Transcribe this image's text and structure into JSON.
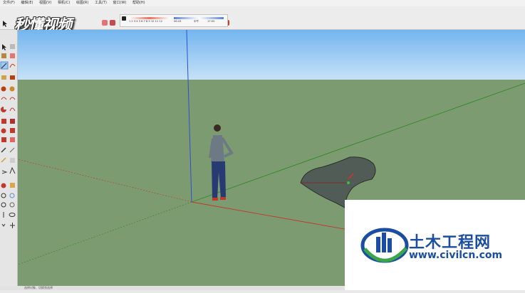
{
  "menu": {
    "items": [
      "文件(F)",
      "编辑(E)",
      "视图(V)",
      "相机(C)",
      "绘图(R)",
      "工具(T)",
      "窗口(W)",
      "帮助(H)"
    ]
  },
  "watermark": {
    "text": "秒懂视频"
  },
  "shadow_panel": {
    "months": "1 2 3 4 5 6 7 8 9 10 11 12",
    "time_start": "06:43",
    "time_mid": "中午",
    "time_end": "17:00"
  },
  "logo": {
    "name_cn": "土木工程网",
    "url": "www.civilcn.com"
  },
  "status": {
    "text": "选择对象、切换到选择"
  },
  "colors": {
    "ground": "#7d9b70",
    "sky_top": "#73b5ef",
    "sky_bottom": "#c6e1f8",
    "axis_blue": "#2b4fd6",
    "axis_green": "#2f8a27",
    "axis_red": "#c0392b",
    "logo_blue": "#1b4ea0",
    "logo_green": "#3aa54a"
  }
}
